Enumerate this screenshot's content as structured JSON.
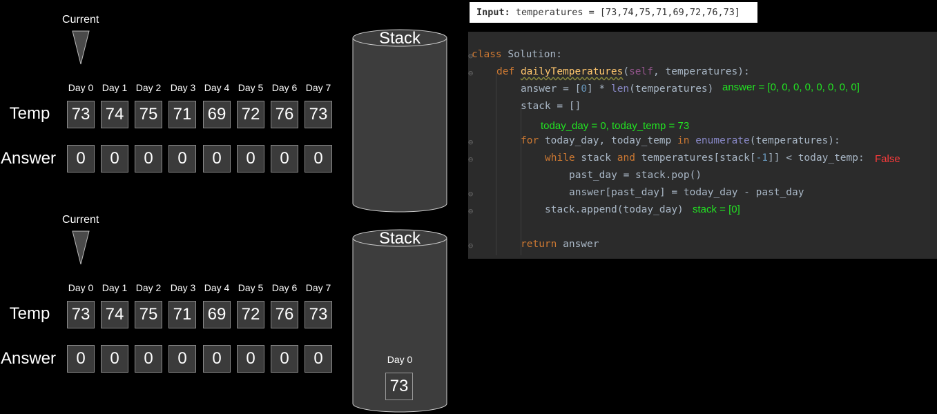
{
  "days": [
    "Day 0",
    "Day 1",
    "Day 2",
    "Day 3",
    "Day 4",
    "Day 5",
    "Day 6",
    "Day 7"
  ],
  "panels": [
    {
      "current_label": "Current",
      "current_index": 0,
      "temp_label": "Temp",
      "answer_label": "Answer",
      "temps": [
        "73",
        "74",
        "75",
        "71",
        "69",
        "72",
        "76",
        "73"
      ],
      "answers": [
        "0",
        "0",
        "0",
        "0",
        "0",
        "0",
        "0",
        "0"
      ],
      "stack_title": "Stack",
      "stack_items": []
    },
    {
      "current_label": "Current",
      "current_index": 0,
      "temp_label": "Temp",
      "answer_label": "Answer",
      "temps": [
        "73",
        "74",
        "75",
        "71",
        "69",
        "72",
        "76",
        "73"
      ],
      "answers": [
        "0",
        "0",
        "0",
        "0",
        "0",
        "0",
        "0",
        "0"
      ],
      "stack_title": "Stack",
      "stack_items": [
        {
          "day": "Day 0",
          "temp": "73"
        }
      ]
    }
  ],
  "input": {
    "label": "Input:",
    "text": "temperatures = [73,74,75,71,69,72,76,73]"
  },
  "code": {
    "class_kw": "class",
    "class_name": " Solution:",
    "def_kw": "def",
    "func_name": "dailyTemperatures",
    "self_kw": "self",
    "params_rest": ", temperatures):",
    "answer_line_a": "answer = [",
    "zero": "0",
    "answer_line_b": "] * ",
    "len_fn": "len",
    "answer_line_c": "(temperatures)",
    "stack_line": "stack = []",
    "for_kw": "for",
    "for_mid": " today_day, today_temp ",
    "in_kw": "in",
    "enumerate_fn": "enumerate",
    "for_end": "(temperatures):",
    "while_kw": "while",
    "while_mid": " stack ",
    "and_kw": "and",
    "while_rest_a": " temperatures[stack[",
    "neg_one": "-1",
    "while_rest_b": "]] < today_temp:",
    "pop_line": "past_day = stack.pop()",
    "assign_line": "answer[past_day] = today_day - past_day",
    "append_line": "stack.append(today_day)",
    "return_kw": "return",
    "return_rest": " answer"
  },
  "annotations": {
    "answer_state": "answer = [0, 0, 0, 0, 0, 0, 0, 0]",
    "loop_state": "today_day = 0, today_temp = 73",
    "while_cond": "False",
    "stack_state": "stack = [0]"
  },
  "colors": {
    "cell_bg": "#3b3b3b",
    "cell_border": "#8a8a8a",
    "annotation_green": "#22e322",
    "annotation_red": "#ff3b3b",
    "code_bg": "#2b2b2b"
  }
}
